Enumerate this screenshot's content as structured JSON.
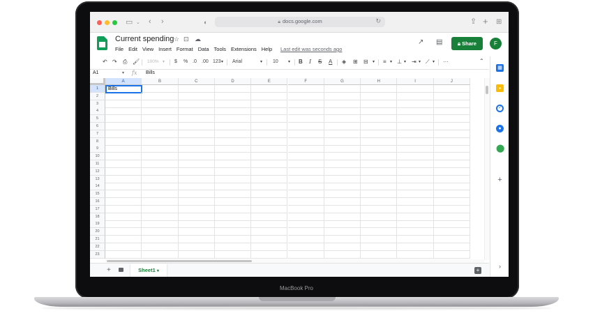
{
  "device": {
    "label": "MacBook Pro"
  },
  "browser": {
    "url": "docs.google.com",
    "icons": [
      "sidebar-icon",
      "back-icon",
      "forward-icon",
      "shield-icon",
      "lock-icon",
      "reload-icon",
      "share-icon",
      "new-tab-icon",
      "tabs-grid-icon"
    ]
  },
  "doc": {
    "title": "Current spending",
    "menu": [
      "File",
      "Edit",
      "View",
      "Insert",
      "Format",
      "Data",
      "Tools",
      "Extensions",
      "Help"
    ],
    "last_edit": "Last edit was seconds ago",
    "share_label": "Share",
    "avatar_initial": "F",
    "accent_color": "#188038"
  },
  "toolbar": {
    "zoom": "100%",
    "currency": "$",
    "percent": "%",
    "dec_decrease": ".0",
    "dec_increase": ".00",
    "more_formats": "123",
    "font": "Arial",
    "font_size": "10",
    "bold": "B",
    "italic": "I",
    "more": "···"
  },
  "formula_bar": {
    "name_box": "A1",
    "fx": "fx",
    "value": "Bills"
  },
  "grid": {
    "columns": [
      "A",
      "B",
      "C",
      "D",
      "E",
      "F",
      "G",
      "H",
      "I",
      "J"
    ],
    "rows": [
      "1",
      "2",
      "3",
      "4",
      "5",
      "6",
      "7",
      "8",
      "9",
      "10",
      "11",
      "12",
      "13",
      "14",
      "15",
      "16",
      "17",
      "18",
      "19",
      "20",
      "21",
      "22",
      "23"
    ],
    "active_cell": "A1",
    "cells": {
      "A1": "Bills"
    }
  },
  "sheets": {
    "tabs": [
      "Sheet1"
    ],
    "active": "Sheet1"
  }
}
